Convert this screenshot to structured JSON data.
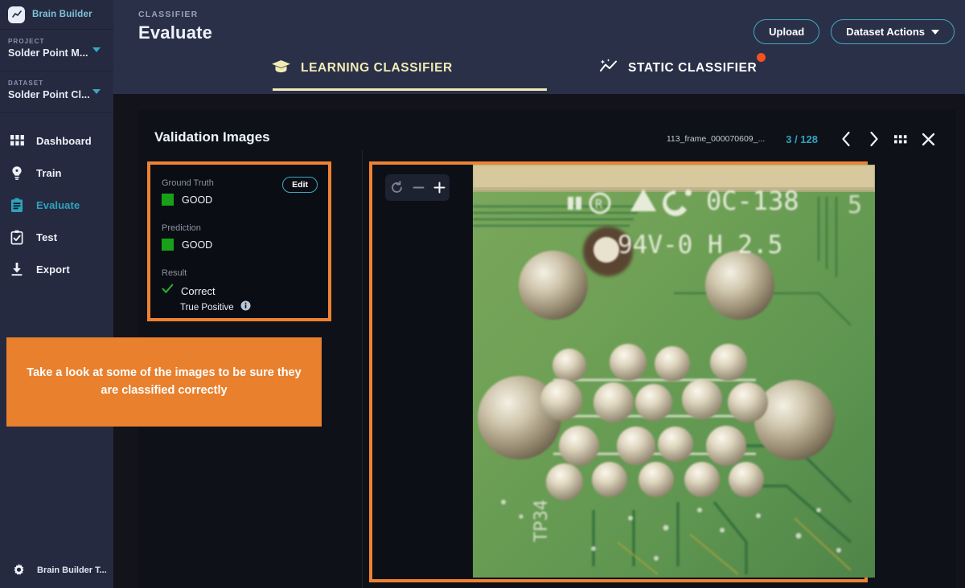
{
  "sidebar": {
    "brand": "Brain Builder",
    "brand_icon": "chart-line-icon",
    "project_label": "PROJECT",
    "project_value": "Solder Point M...",
    "dataset_label": "DATASET",
    "dataset_value": "Solder Point Cl...",
    "nav": [
      {
        "label": "Dashboard",
        "icon": "grid-icon",
        "active": false
      },
      {
        "label": "Train",
        "icon": "lightbulb-icon",
        "active": false
      },
      {
        "label": "Evaluate",
        "icon": "clipboard-list-icon",
        "active": true
      },
      {
        "label": "Test",
        "icon": "clipboard-check-icon",
        "active": false
      },
      {
        "label": "Export",
        "icon": "download-icon",
        "active": false
      }
    ],
    "footer_label": "Brain Builder T...",
    "footer_icon": "gear-icon"
  },
  "header": {
    "kicker": "CLASSIFIER",
    "title": "Evaluate",
    "upload_button": "Upload",
    "dataset_actions_button": "Dataset Actions"
  },
  "tabs": [
    {
      "label": "LEARNING CLASSIFIER",
      "icon": "graduation-cap-icon",
      "active": true,
      "badge": false
    },
    {
      "label": "STATIC CLASSIFIER",
      "icon": "sparkle-chart-icon",
      "active": false,
      "badge": true
    }
  ],
  "panel": {
    "title": "Validation Images",
    "file_name": "113_frame_000070609_...",
    "counter": "3 / 128",
    "prev_icon": "chevron-left-icon",
    "next_icon": "chevron-right-icon",
    "grid_icon": "grid-view-icon",
    "close_icon": "close-icon"
  },
  "info_card": {
    "ground_truth_label": "Ground Truth",
    "ground_truth_value": "GOOD",
    "edit_button": "Edit",
    "prediction_label": "Prediction",
    "prediction_value": "GOOD",
    "result_label": "Result",
    "result_value": "Correct",
    "result_detail": "True Positive",
    "info_icon": "info-circle-icon",
    "check_icon": "check-icon",
    "swatch_color": "#18a018"
  },
  "callout": {
    "text": "Take a look at some of the images to be sure they are classified correctly",
    "color": "#e8802e"
  },
  "viewer": {
    "reset_icon": "rotate-reset-icon",
    "zoom_out_icon": "minus-icon",
    "zoom_in_icon": "plus-icon",
    "image_alt": "pcb-solder-points-photo",
    "pcb_text_line1": "0C-138",
    "pcb_text_line2": "94V-0 H 2.5",
    "highlight_color": "#ef8232"
  },
  "theme": {
    "sidebar_bg": "#252a40",
    "topbar_bg": "#2b3049",
    "content_bg": "#12131b",
    "accent_teal": "#3fa9bd",
    "accent_orange": "#ef8232",
    "tab_active": "#f1ecb4",
    "badge_orange": "#f4511e"
  }
}
